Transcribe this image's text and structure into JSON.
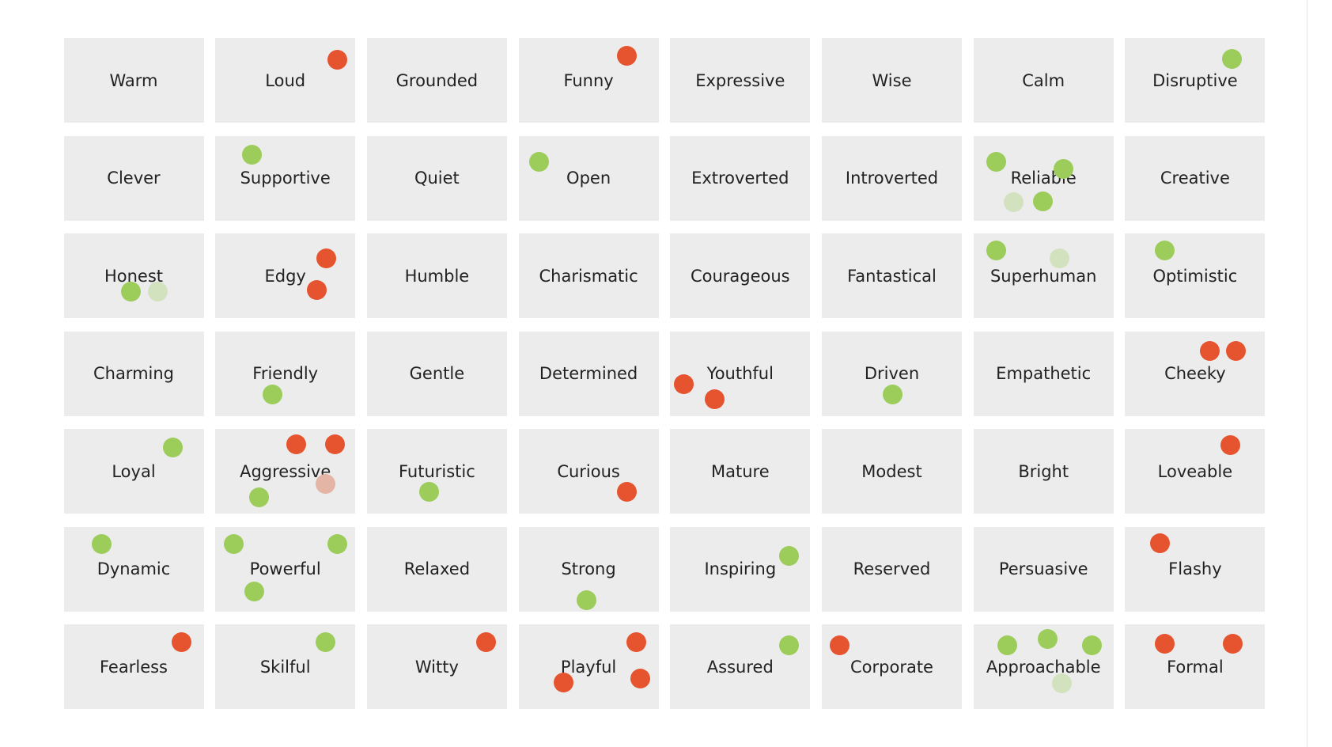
{
  "colors": {
    "cell_bg": "#ececec",
    "green": "#9ccc5a",
    "red": "#e5532f",
    "lightgreen": "#d2e2bf",
    "pink": "#e4b4a4"
  },
  "grid": {
    "columns": 8,
    "cells": [
      {
        "label": "Warm",
        "dots": []
      },
      {
        "label": "Loud",
        "dots": [
          "red"
        ]
      },
      {
        "label": "Grounded",
        "dots": []
      },
      {
        "label": "Funny",
        "dots": [
          "red"
        ]
      },
      {
        "label": "Expressive",
        "dots": []
      },
      {
        "label": "Wise",
        "dots": []
      },
      {
        "label": "Calm",
        "dots": []
      },
      {
        "label": "Disruptive",
        "dots": [
          "green"
        ]
      },
      {
        "label": "Clever",
        "dots": []
      },
      {
        "label": "Supportive",
        "dots": [
          "green"
        ]
      },
      {
        "label": "Quiet",
        "dots": []
      },
      {
        "label": "Open",
        "dots": [
          "green"
        ]
      },
      {
        "label": "Extroverted",
        "dots": []
      },
      {
        "label": "Introverted",
        "dots": []
      },
      {
        "label": "Reliable",
        "dots": [
          "green",
          "green",
          "lightgreen",
          "green"
        ]
      },
      {
        "label": "Creative",
        "dots": []
      },
      {
        "label": "Honest",
        "dots": [
          "green",
          "lightgreen"
        ]
      },
      {
        "label": "Edgy",
        "dots": [
          "red",
          "red"
        ]
      },
      {
        "label": "Humble",
        "dots": []
      },
      {
        "label": "Charismatic",
        "dots": []
      },
      {
        "label": "Courageous",
        "dots": []
      },
      {
        "label": "Fantastical",
        "dots": []
      },
      {
        "label": "Superhuman",
        "dots": [
          "green",
          "lightgreen"
        ]
      },
      {
        "label": "Optimistic",
        "dots": [
          "green"
        ]
      },
      {
        "label": "Charming",
        "dots": []
      },
      {
        "label": "Friendly",
        "dots": [
          "green"
        ]
      },
      {
        "label": "Gentle",
        "dots": []
      },
      {
        "label": "Determined",
        "dots": []
      },
      {
        "label": "Youthful",
        "dots": [
          "red",
          "red"
        ]
      },
      {
        "label": "Driven",
        "dots": [
          "green"
        ]
      },
      {
        "label": "Empathetic",
        "dots": []
      },
      {
        "label": "Cheeky",
        "dots": [
          "red",
          "red"
        ]
      },
      {
        "label": "Loyal",
        "dots": [
          "green"
        ]
      },
      {
        "label": "Aggressive",
        "dots": [
          "red",
          "red",
          "green",
          "pink"
        ]
      },
      {
        "label": "Futuristic",
        "dots": [
          "green"
        ]
      },
      {
        "label": "Curious",
        "dots": [
          "red"
        ]
      },
      {
        "label": "Mature",
        "dots": []
      },
      {
        "label": "Modest",
        "dots": []
      },
      {
        "label": "Bright",
        "dots": []
      },
      {
        "label": "Loveable",
        "dots": [
          "red"
        ]
      },
      {
        "label": "Dynamic",
        "dots": [
          "green"
        ]
      },
      {
        "label": "Powerful",
        "dots": [
          "green",
          "green",
          "green"
        ]
      },
      {
        "label": "Relaxed",
        "dots": []
      },
      {
        "label": "Strong",
        "dots": [
          "green"
        ]
      },
      {
        "label": "Inspiring",
        "dots": [
          "green"
        ]
      },
      {
        "label": "Reserved",
        "dots": []
      },
      {
        "label": "Persuasive",
        "dots": []
      },
      {
        "label": "Flashy",
        "dots": [
          "red"
        ]
      },
      {
        "label": "Fearless",
        "dots": [
          "red"
        ]
      },
      {
        "label": "Skilful",
        "dots": [
          "green"
        ]
      },
      {
        "label": "Witty",
        "dots": [
          "red"
        ]
      },
      {
        "label": "Playful",
        "dots": [
          "red",
          "red",
          "red"
        ]
      },
      {
        "label": "Assured",
        "dots": [
          "green"
        ]
      },
      {
        "label": "Corporate",
        "dots": [
          "red"
        ]
      },
      {
        "label": "Approachable",
        "dots": [
          "green",
          "green",
          "green",
          "lightgreen"
        ]
      },
      {
        "label": "Formal",
        "dots": [
          "red",
          "red"
        ]
      }
    ]
  }
}
